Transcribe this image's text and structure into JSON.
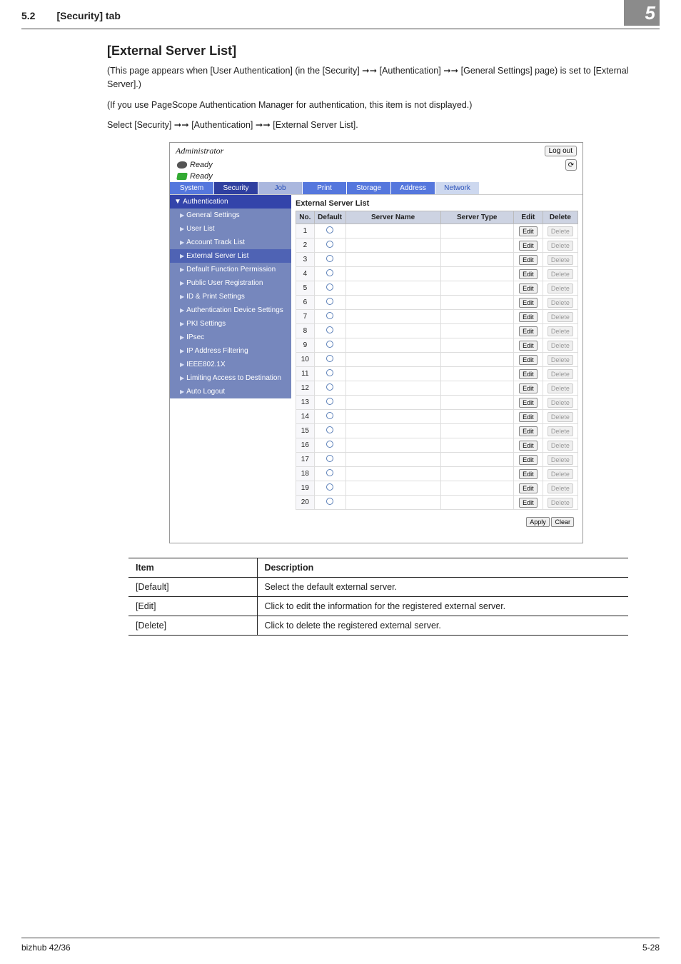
{
  "header": {
    "section": "5.2",
    "tab": "[Security] tab",
    "chapter": "5"
  },
  "title": "[External Server List]",
  "paragraphs": [
    "(This page appears when [User Authentication] (in the [Security] ➞➞ [Authentication] ➞➞ [General Settings] page) is set to [External Server].)",
    "(If you use PageScope Authentication Manager for authentication, this item is not displayed.)",
    "Select [Security] ➞➞ [Authentication] ➞➞ [External Server List]."
  ],
  "screenshot": {
    "admin_label": "Administrator",
    "logout": "Log out",
    "ready": "Ready",
    "tabs": [
      "System",
      "Security",
      "Job",
      "Print",
      "Storage",
      "Address",
      "Network"
    ],
    "active_tab_index": 1,
    "sidebar": {
      "header": "▼ Authentication",
      "items": [
        "General Settings",
        "User List",
        "Account Track List",
        "External Server List",
        "Default Function Permission",
        "Public User Registration",
        "ID & Print Settings",
        "Authentication Device Settings",
        "PKI Settings",
        "IPsec",
        "IP Address Filtering",
        "IEEE802.1X",
        "Limiting Access to Destination",
        "Auto Logout"
      ],
      "active_index": 3
    },
    "panel_title": "External Server List",
    "cols": {
      "no": "No.",
      "default": "Default",
      "sname": "Server Name",
      "stype": "Server Type",
      "edit": "Edit",
      "delete": "Delete"
    },
    "rows": [
      {
        "no": "1"
      },
      {
        "no": "2"
      },
      {
        "no": "3"
      },
      {
        "no": "4"
      },
      {
        "no": "5"
      },
      {
        "no": "6"
      },
      {
        "no": "7"
      },
      {
        "no": "8"
      },
      {
        "no": "9"
      },
      {
        "no": "10"
      },
      {
        "no": "11"
      },
      {
        "no": "12"
      },
      {
        "no": "13"
      },
      {
        "no": "14"
      },
      {
        "no": "15"
      },
      {
        "no": "16"
      },
      {
        "no": "17"
      },
      {
        "no": "18"
      },
      {
        "no": "19"
      },
      {
        "no": "20"
      }
    ],
    "edit_btn": "Edit",
    "delete_btn": "Delete",
    "apply": "Apply",
    "clear": "Clear"
  },
  "desc_table": {
    "head": {
      "item": "Item",
      "desc": "Description"
    },
    "rows": [
      {
        "item": "[Default]",
        "desc": "Select the default external server."
      },
      {
        "item": "[Edit]",
        "desc": "Click to edit the information for the registered external server."
      },
      {
        "item": "[Delete]",
        "desc": "Click to delete the registered external server."
      }
    ]
  },
  "footer": {
    "left": "bizhub 42/36",
    "right": "5-28"
  }
}
